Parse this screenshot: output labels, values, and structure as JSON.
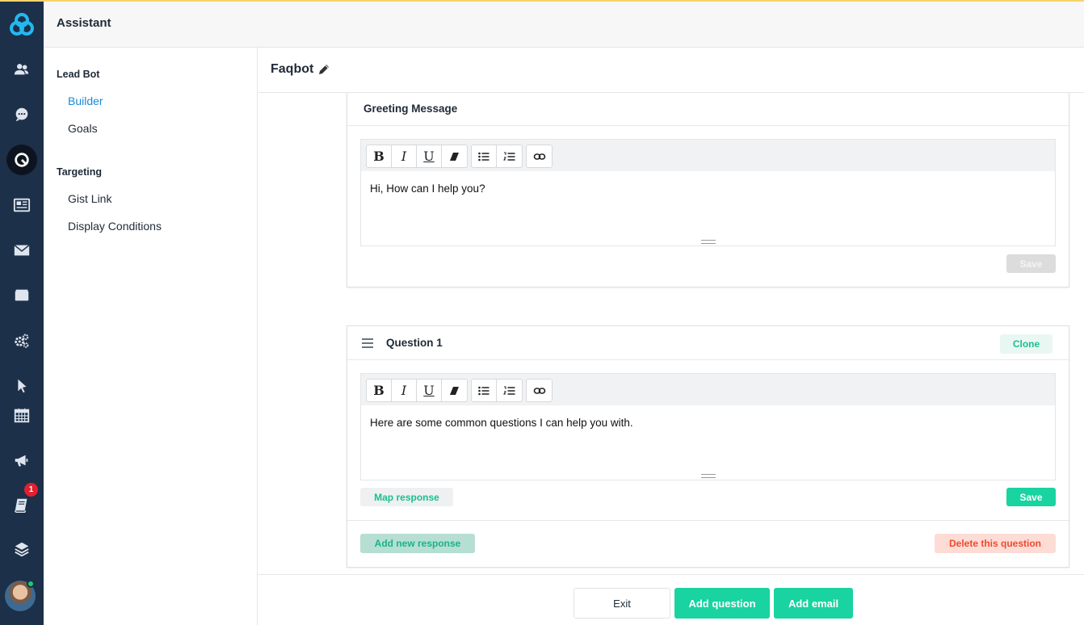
{
  "app": {
    "title": "Assistant",
    "badge_count": "1",
    "accent": "#19d3a0",
    "rail_bg": "#1d3049"
  },
  "rail": {
    "items": [
      {
        "icon": "users-icon"
      },
      {
        "icon": "chat-icon"
      },
      {
        "icon": "bot-icon",
        "active": true
      },
      {
        "icon": "newspaper-icon"
      },
      {
        "icon": "mail-icon"
      },
      {
        "icon": "inbox-icon"
      },
      {
        "icon": "gears-icon"
      },
      {
        "icon": "pointer-icon"
      },
      {
        "icon": "calendar-icon"
      },
      {
        "icon": "megaphone-icon"
      },
      {
        "icon": "knowledge-book-icon"
      },
      {
        "icon": "layers-icon"
      }
    ]
  },
  "subnav": {
    "lead_bot": "Lead Bot",
    "builder": "Builder",
    "goals": "Goals",
    "targeting": "Targeting",
    "gist_link": "Gist Link",
    "display_conditions": "Display Conditions"
  },
  "main": {
    "bot_name": "Faqbot",
    "greeting": {
      "title": "Greeting Message",
      "text": "Hi, How can I help you?",
      "save": "Save"
    },
    "question": {
      "title": "Question 1",
      "clone": "Clone",
      "text": "Here are some common questions I can help you with.",
      "map_response": "Map response",
      "save": "Save",
      "add_response": "Add new response",
      "delete": "Delete this question"
    },
    "toolbar": {
      "bold": "B",
      "italic": "I",
      "underline": "U"
    }
  },
  "footer": {
    "exit": "Exit",
    "add_question": "Add question",
    "add_email": "Add email"
  }
}
